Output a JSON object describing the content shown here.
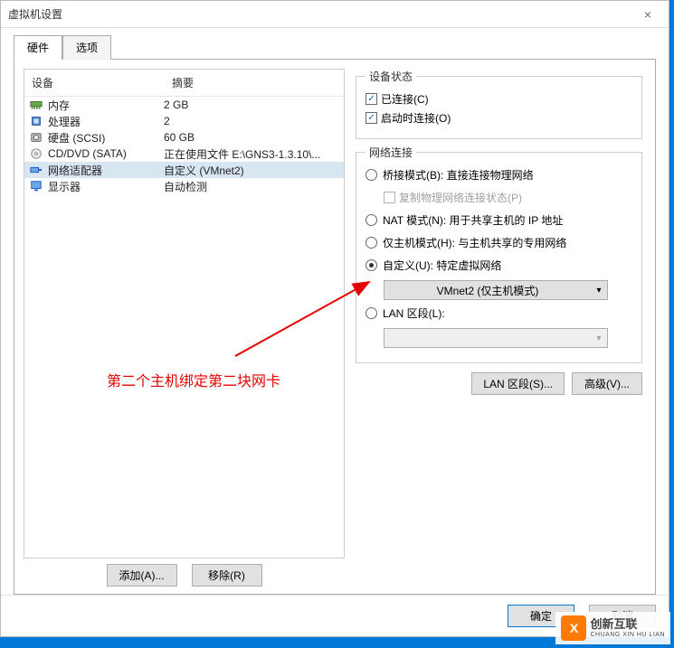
{
  "window": {
    "title": "虚拟机设置",
    "close_icon": "×"
  },
  "tabs": {
    "hardware": "硬件",
    "options": "选项"
  },
  "list": {
    "header_device": "设备",
    "header_summary": "摘要",
    "rows": [
      {
        "icon": "memory",
        "name": "内存",
        "summary": "2 GB"
      },
      {
        "icon": "cpu",
        "name": "处理器",
        "summary": "2"
      },
      {
        "icon": "disk",
        "name": "硬盘 (SCSI)",
        "summary": "60 GB"
      },
      {
        "icon": "cd",
        "name": "CD/DVD (SATA)",
        "summary": "正在使用文件 E:\\GNS3-1.3.10\\..."
      },
      {
        "icon": "net",
        "name": "网络适配器",
        "summary": "自定义 (VMnet2)",
        "selected": true
      },
      {
        "icon": "display",
        "name": "显示器",
        "summary": "自动检测"
      }
    ]
  },
  "buttons": {
    "add": "添加(A)...",
    "remove": "移除(R)",
    "ok": "确定",
    "cancel": "取消",
    "lan_segments": "LAN 区段(S)...",
    "advanced": "高级(V)..."
  },
  "status": {
    "legend": "设备状态",
    "connected": "已连接(C)",
    "connect_at_power": "启动时连接(O)"
  },
  "net": {
    "legend": "网络连接",
    "bridged": "桥接模式(B): 直接连接物理网络",
    "replicate": "复制物理网络连接状态(P)",
    "nat": "NAT 模式(N): 用于共享主机的 IP 地址",
    "hostonly": "仅主机模式(H): 与主机共享的专用网络",
    "custom": "自定义(U): 特定虚拟网络",
    "custom_value": "VMnet2 (仅主机模式)",
    "lan": "LAN 区段(L):",
    "lan_value": ""
  },
  "annotation": {
    "text": "第二个主机绑定第二块网卡"
  },
  "brand": {
    "name": "创新互联",
    "sub": "CHUANG XIN HU LIAN"
  }
}
